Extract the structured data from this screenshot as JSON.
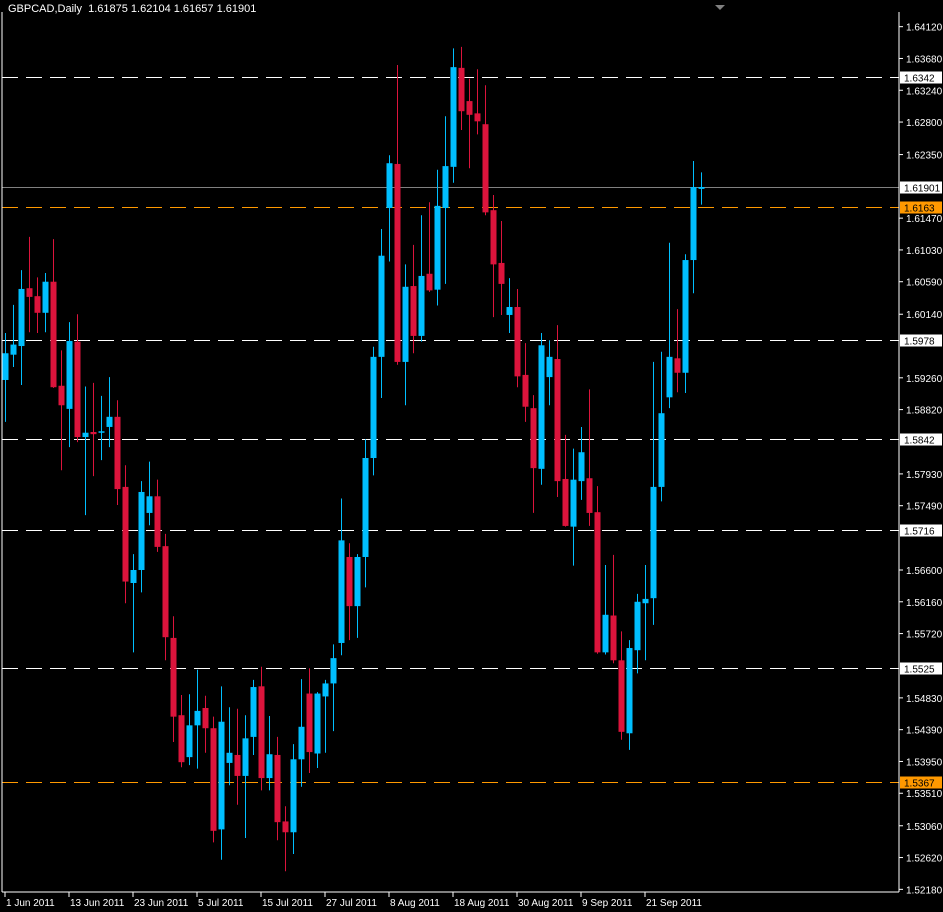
{
  "chart_data": {
    "type": "candlestick",
    "symbol": "GBPCAD",
    "timeframe": "Daily",
    "header": {
      "symbol_tf": "GBPCAD,Daily",
      "open": "1.61875",
      "high": "1.62104",
      "low": "1.61657",
      "close": "1.61901"
    },
    "ylim": [
      1.519,
      1.644
    ],
    "y_ticks": [
      "1.64120",
      "1.63680",
      "1.63240",
      "1.62800",
      "1.62350",
      "1.61470",
      "1.61030",
      "1.60590",
      "1.60140",
      "1.59260",
      "1.58820",
      "1.57930",
      "1.57490",
      "1.56600",
      "1.56160",
      "1.55720",
      "1.54830",
      "1.54390",
      "1.53950",
      "1.53510",
      "1.53060",
      "1.52620",
      "1.52180"
    ],
    "x_ticks": [
      {
        "index": 0,
        "label": "1 Jun 2011"
      },
      {
        "index": 8,
        "label": "13 Jun 2011"
      },
      {
        "index": 16,
        "label": "23 Jun 2011"
      },
      {
        "index": 24,
        "label": "5 Jul 2011"
      },
      {
        "index": 32,
        "label": "15 Jul 2011"
      },
      {
        "index": 40,
        "label": "27 Jul 2011"
      },
      {
        "index": 48,
        "label": "8 Aug 2011"
      },
      {
        "index": 56,
        "label": "18 Aug 2011"
      },
      {
        "index": 64,
        "label": "30 Aug 2011"
      },
      {
        "index": 72,
        "label": "9 Sep 2011"
      },
      {
        "index": 80,
        "label": "21 Sep 2011"
      }
    ],
    "ohlc": [
      [
        1.5923,
        1.5988,
        1.5865,
        1.596
      ],
      [
        1.5958,
        1.6027,
        1.5941,
        1.5972
      ],
      [
        1.597,
        1.6075,
        1.5916,
        1.6049
      ],
      [
        1.605,
        1.6121,
        1.5989,
        1.6038
      ],
      [
        1.6039,
        1.6065,
        1.5988,
        1.6016
      ],
      [
        1.6016,
        1.6071,
        1.5989,
        1.6059
      ],
      [
        1.6059,
        1.6118,
        1.5912,
        1.5913
      ],
      [
        1.5915,
        1.5964,
        1.5798,
        1.5888
      ],
      [
        1.5883,
        1.6003,
        1.583,
        1.5977
      ],
      [
        1.5976,
        1.6014,
        1.5837,
        1.5844
      ],
      [
        1.5844,
        1.5914,
        1.5736,
        1.585
      ],
      [
        1.5851,
        1.5919,
        1.579,
        1.5848
      ],
      [
        1.585,
        1.5901,
        1.5812,
        1.5852
      ],
      [
        1.5858,
        1.5927,
        1.583,
        1.5872
      ],
      [
        1.5872,
        1.5895,
        1.575,
        1.5772
      ],
      [
        1.5775,
        1.5805,
        1.5614,
        1.5644
      ],
      [
        1.5642,
        1.5682,
        1.5546,
        1.566
      ],
      [
        1.566,
        1.5783,
        1.5629,
        1.5768
      ],
      [
        1.5739,
        1.581,
        1.5722,
        1.5762
      ],
      [
        1.5762,
        1.5785,
        1.5685,
        1.5692
      ],
      [
        1.5693,
        1.571,
        1.5535,
        1.5567
      ],
      [
        1.5566,
        1.5596,
        1.5422,
        1.5457
      ],
      [
        1.5459,
        1.5487,
        1.5387,
        1.5394
      ],
      [
        1.5401,
        1.5488,
        1.539,
        1.5445
      ],
      [
        1.5445,
        1.5522,
        1.5385,
        1.5465
      ],
      [
        1.5469,
        1.5486,
        1.5407,
        1.5441
      ],
      [
        1.5441,
        1.5457,
        1.5283,
        1.5299
      ],
      [
        1.5301,
        1.5499,
        1.5259,
        1.545
      ],
      [
        1.5393,
        1.547,
        1.5362,
        1.5407
      ],
      [
        1.5404,
        1.5468,
        1.5335,
        1.5375
      ],
      [
        1.5375,
        1.5459,
        1.5289,
        1.5427
      ],
      [
        1.5429,
        1.5508,
        1.5404,
        1.5498
      ],
      [
        1.5499,
        1.5526,
        1.5355,
        1.5372
      ],
      [
        1.5372,
        1.5458,
        1.5355,
        1.5405
      ],
      [
        1.5404,
        1.5429,
        1.5286,
        1.5311
      ],
      [
        1.5312,
        1.5333,
        1.5243,
        1.5297
      ],
      [
        1.5297,
        1.5419,
        1.5267,
        1.5398
      ],
      [
        1.5398,
        1.5509,
        1.536,
        1.5443
      ],
      [
        1.5489,
        1.5524,
        1.5379,
        1.5408
      ],
      [
        1.5406,
        1.5491,
        1.5386,
        1.5489
      ],
      [
        1.5485,
        1.5508,
        1.5407,
        1.5503
      ],
      [
        1.5503,
        1.5557,
        1.5437,
        1.5538
      ],
      [
        1.5559,
        1.5759,
        1.5542,
        1.5701
      ],
      [
        1.5678,
        1.5697,
        1.5563,
        1.561
      ],
      [
        1.561,
        1.5682,
        1.5566,
        1.5678
      ],
      [
        1.5678,
        1.5841,
        1.5636,
        1.5815
      ],
      [
        1.5815,
        1.5969,
        1.5791,
        1.5955
      ],
      [
        1.5955,
        1.6132,
        1.5898,
        1.6095
      ],
      [
        1.6161,
        1.6234,
        1.6087,
        1.6223
      ],
      [
        1.6222,
        1.6359,
        1.5944,
        1.5948
      ],
      [
        1.5948,
        1.6083,
        1.5888,
        1.6052
      ],
      [
        1.6053,
        1.611,
        1.596,
        1.5984
      ],
      [
        1.5984,
        1.6151,
        1.5976,
        1.6067
      ],
      [
        1.607,
        1.6169,
        1.6045,
        1.6047
      ],
      [
        1.6048,
        1.6214,
        1.6026,
        1.6164
      ],
      [
        1.6161,
        1.6288,
        1.6056,
        1.6219
      ],
      [
        1.6218,
        1.6382,
        1.6196,
        1.6356
      ],
      [
        1.6355,
        1.6384,
        1.6269,
        1.6295
      ],
      [
        1.6309,
        1.634,
        1.6216,
        1.629
      ],
      [
        1.6292,
        1.6353,
        1.6263,
        1.6281
      ],
      [
        1.6277,
        1.6331,
        1.6151,
        1.6155
      ],
      [
        1.6158,
        1.6179,
        1.601,
        1.6083
      ],
      [
        1.6085,
        1.6143,
        1.6013,
        1.6056
      ],
      [
        1.6013,
        1.6064,
        1.5988,
        1.6024
      ],
      [
        1.6024,
        1.6049,
        1.5913,
        1.5928
      ],
      [
        1.593,
        1.5974,
        1.5865,
        1.5886
      ],
      [
        1.5884,
        1.5902,
        1.5739,
        1.5801
      ],
      [
        1.58,
        1.5988,
        1.5778,
        1.5971
      ],
      [
        1.5927,
        1.5978,
        1.5888,
        1.5955
      ],
      [
        1.5952,
        1.5999,
        1.5761,
        1.5783
      ],
      [
        1.5786,
        1.5847,
        1.572,
        1.5721
      ],
      [
        1.572,
        1.5828,
        1.5666,
        1.5785
      ],
      [
        1.5783,
        1.5858,
        1.5757,
        1.5823
      ],
      [
        1.5787,
        1.591,
        1.5721,
        1.5739
      ],
      [
        1.574,
        1.5776,
        1.5544,
        1.5546
      ],
      [
        1.5546,
        1.5667,
        1.5543,
        1.5598
      ],
      [
        1.5597,
        1.5681,
        1.5531,
        1.5535
      ],
      [
        1.5535,
        1.5575,
        1.5425,
        1.5436
      ],
      [
        1.5434,
        1.5563,
        1.5411,
        1.5552
      ],
      [
        1.5549,
        1.5627,
        1.5517,
        1.5616
      ],
      [
        1.5614,
        1.5667,
        1.5535,
        1.562
      ],
      [
        1.5621,
        1.5948,
        1.5584,
        1.5775
      ],
      [
        1.5775,
        1.5962,
        1.5755,
        1.5877
      ],
      [
        1.5899,
        1.6113,
        1.5884,
        1.5955
      ],
      [
        1.5953,
        1.6021,
        1.5906,
        1.5933
      ],
      [
        1.5933,
        1.6097,
        1.5905,
        1.6089
      ],
      [
        1.6089,
        1.6226,
        1.6043,
        1.619
      ],
      [
        1.61875,
        1.62104,
        1.61657,
        1.61901
      ]
    ],
    "horizontal_lines": [
      {
        "price": 1.6342,
        "label": "1.6342",
        "kind": "level",
        "color": "#ffffff"
      },
      {
        "price": 1.6163,
        "label": "1.6163",
        "kind": "level",
        "color": "#ff9900"
      },
      {
        "price": 1.5978,
        "label": "1.5978",
        "kind": "level",
        "color": "#ffffff"
      },
      {
        "price": 1.5842,
        "label": "1.5842",
        "kind": "level",
        "color": "#ffffff"
      },
      {
        "price": 1.5716,
        "label": "1.5716",
        "kind": "level",
        "color": "#ffffff"
      },
      {
        "price": 1.5525,
        "label": "1.5525",
        "kind": "level",
        "color": "#ffffff"
      },
      {
        "price": 1.5367,
        "label": "1.5367",
        "kind": "level",
        "color": "#ff9900"
      }
    ],
    "current_price": {
      "price": 1.61901,
      "label": "1.61901",
      "color": "#808080"
    },
    "colors": {
      "background": "#000000",
      "bull": "#00bfff",
      "bear": "#dc143c",
      "axis": "#ffffff",
      "text": "#ffffff"
    }
  }
}
